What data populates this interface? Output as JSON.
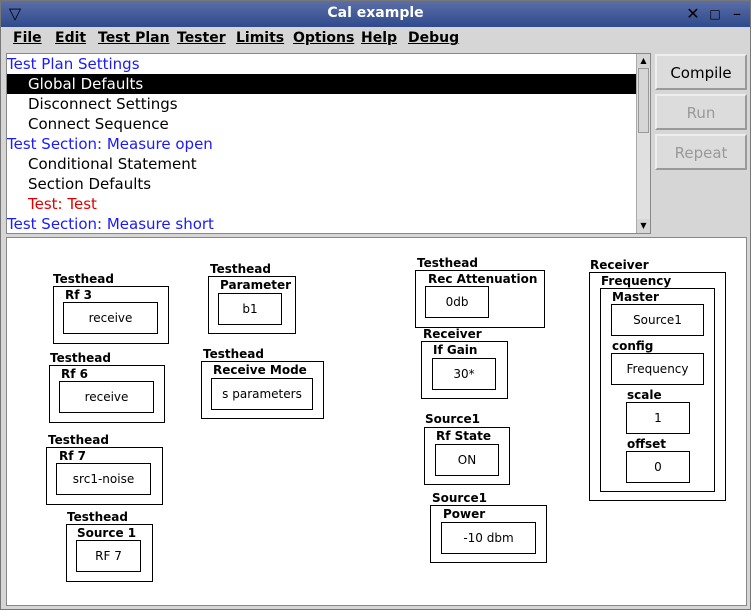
{
  "window": {
    "title": "Cal example"
  },
  "menus": [
    "File",
    "Edit",
    "Test Plan",
    "Tester",
    "Limits",
    "Options",
    "Help",
    "Debug"
  ],
  "tree": [
    {
      "label": "Test Plan Settings",
      "kind": "sec"
    },
    {
      "label": "Global Defaults",
      "kind": "sel"
    },
    {
      "label": "Disconnect Settings",
      "kind": "item"
    },
    {
      "label": "Connect Sequence",
      "kind": "item"
    },
    {
      "label": "Test Section: Measure open",
      "kind": "sec"
    },
    {
      "label": "Conditional Statement",
      "kind": "item"
    },
    {
      "label": "Section Defaults",
      "kind": "item"
    },
    {
      "label": "Test: Test",
      "kind": "red"
    },
    {
      "label": "Test Section: Measure short",
      "kind": "sec"
    }
  ],
  "buttons": {
    "compile": "Compile",
    "run": "Run",
    "repeat": "Repeat"
  },
  "blocks": {
    "b1": {
      "outer": "Testhead",
      "param": "Rf 3",
      "value": "receive"
    },
    "b2": {
      "outer": "Testhead",
      "param": "Rf 6",
      "value": "receive"
    },
    "b3": {
      "outer": "Testhead",
      "param": "Rf 7",
      "value": "src1-noise"
    },
    "b4": {
      "outer": "Testhead",
      "param": "Source 1",
      "value": "RF 7"
    },
    "b5": {
      "outer": "Testhead",
      "param": "Parameter",
      "value": "b1"
    },
    "b6": {
      "outer": "Testhead",
      "param": "Receive Mode",
      "value": "s parameters"
    },
    "b7": {
      "outer": "Testhead",
      "param": "Rec Attenuation",
      "value": "0db"
    },
    "b8": {
      "outer": "Receiver",
      "param": "If Gain",
      "value": "30*"
    },
    "b9": {
      "outer": "Source1",
      "param": "Rf State",
      "value": "ON"
    },
    "b10": {
      "outer": "Source1",
      "param": "Power",
      "value": "-10  dbm"
    },
    "rx": {
      "outer": "Receiver",
      "freq": "Frequency",
      "master": "Master",
      "master_val": "Source1",
      "config": "config",
      "config_val": "Frequency",
      "scale": "scale",
      "scale_val": "1",
      "offset": "offset",
      "offset_val": "0"
    }
  }
}
